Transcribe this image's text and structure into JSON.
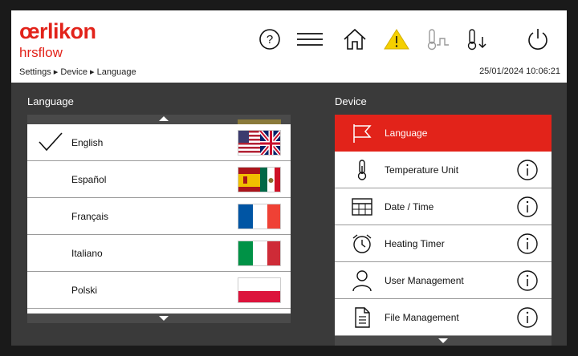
{
  "header": {
    "brand": "œrlikon",
    "sub_brand": "hrsflow",
    "breadcrumb": "Settings ▸ Device ▸ Language",
    "datetime": "25/01/2024 10:06:21",
    "icons": [
      "help-icon",
      "menu-icon",
      "home-icon",
      "warning-icon",
      "temperature-icon",
      "temperature-down-icon",
      "power-icon"
    ]
  },
  "language_panel": {
    "title": "Language",
    "items": [
      {
        "label": "English",
        "selected": true,
        "flag": "uk-us"
      },
      {
        "label": "Español",
        "selected": false,
        "flag": "es-mx"
      },
      {
        "label": "Français",
        "selected": false,
        "flag": "fr"
      },
      {
        "label": "Italiano",
        "selected": false,
        "flag": "it"
      },
      {
        "label": "Polski",
        "selected": false,
        "flag": "pl"
      }
    ]
  },
  "device_panel": {
    "title": "Device",
    "items": [
      {
        "label": "Language",
        "icon": "flag-icon",
        "active": true
      },
      {
        "label": "Temperature Unit",
        "icon": "thermometer-icon",
        "active": false
      },
      {
        "label": "Date / Time",
        "icon": "calendar-icon",
        "active": false
      },
      {
        "label": "Heating Timer",
        "icon": "alarm-clock-icon",
        "active": false
      },
      {
        "label": "User Management",
        "icon": "user-icon",
        "active": false
      },
      {
        "label": "File Management",
        "icon": "file-icon",
        "active": false
      }
    ]
  },
  "colors": {
    "accent": "#e2231a",
    "background": "#3a3a3a",
    "warning": "#f5d000"
  }
}
